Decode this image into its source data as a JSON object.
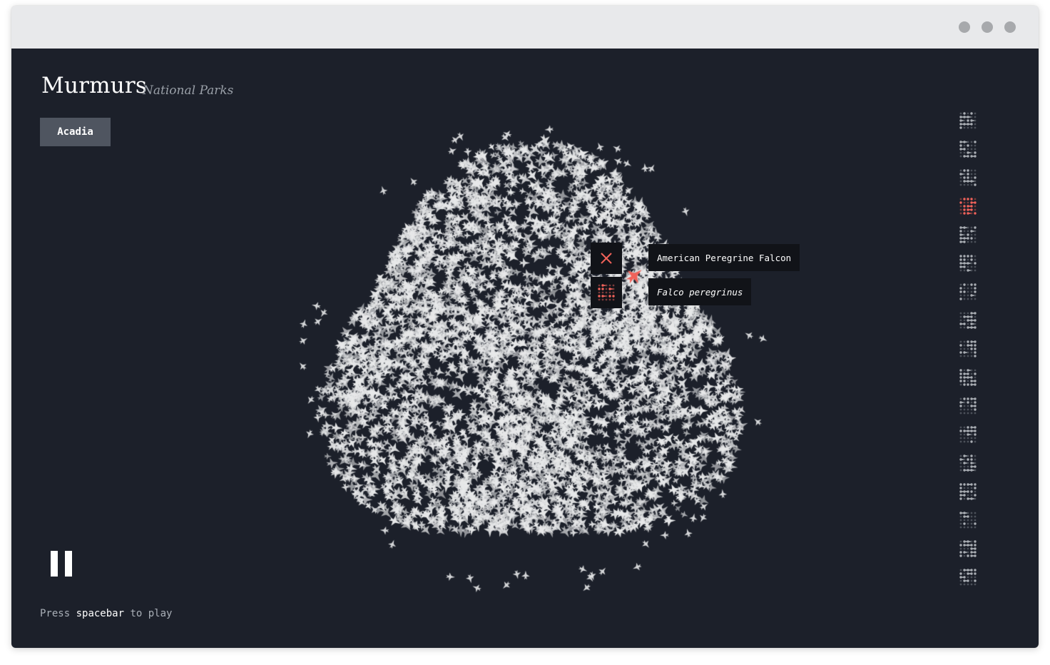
{
  "app": {
    "title": "Murmurs",
    "subtitle": "National Parks"
  },
  "park_selector": {
    "label": "Acadia"
  },
  "selected_bird": {
    "common_name": "American Peregrine Falcon",
    "scientific_name": "Falco peregrinus",
    "close_icon": "close-icon",
    "species_icon": "dot-matrix-species-icon"
  },
  "species_icons": {
    "count": 17,
    "selected_index": 3,
    "icon": "dot-matrix-species-icon"
  },
  "playback": {
    "state_icon": "pause-icon",
    "hint_prefix": "Press",
    "hint_key": "spacebar",
    "hint_suffix": "to play"
  },
  "colors": {
    "background": "#1c202a",
    "bird": "#e8e9ea",
    "accent": "#f0625a",
    "button": "#4f5560",
    "titlebar": "#e8e9eb"
  }
}
